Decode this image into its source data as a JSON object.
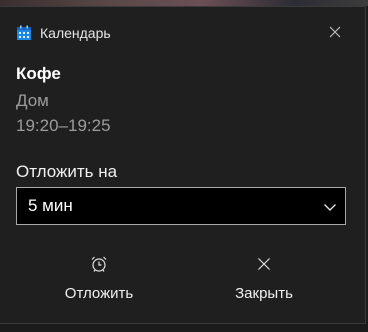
{
  "header": {
    "app_name": "Календарь",
    "app_icon": "calendar-icon",
    "close_icon": "close-icon"
  },
  "event": {
    "title": "Кофе",
    "location": "Дом",
    "time": "19:20–19:25"
  },
  "snooze": {
    "label": "Отложить на",
    "selected": "5 мин"
  },
  "actions": [
    {
      "label": "Отложить",
      "icon": "alarm-clock-icon"
    },
    {
      "label": "Закрыть",
      "icon": "close-icon"
    }
  ],
  "colors": {
    "background": "#1f1f1f",
    "accent": "#0078d7",
    "text": "#ffffff",
    "secondary_text": "#9c9c9c"
  }
}
